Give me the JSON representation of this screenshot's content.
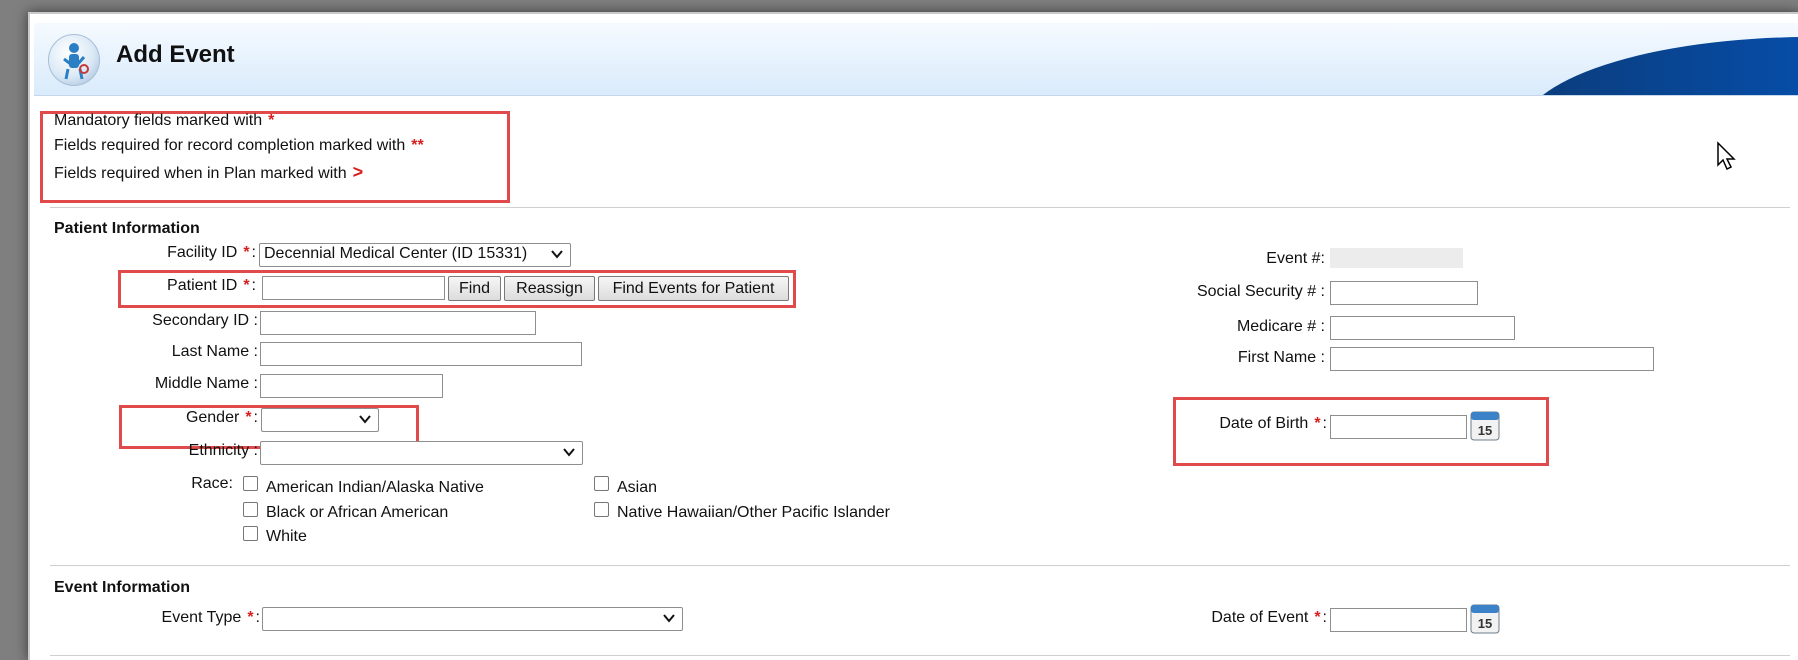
{
  "page": {
    "title": "Add Event"
  },
  "legend": {
    "mandatory": "Mandatory fields marked with",
    "mandatory_mark": "*",
    "completion": "Fields required for record completion marked with",
    "completion_mark": "**",
    "plan": "Fields required when in Plan marked with",
    "plan_mark": ">"
  },
  "patient": {
    "section_title": "Patient Information",
    "facility_label": "Facility ID",
    "facility_value": "Decennial Medical Center (ID 15331)",
    "patient_id_label": "Patient ID",
    "patient_id_value": "",
    "find_button": "Find",
    "reassign_button": "Reassign",
    "find_events_button": "Find Events for Patient",
    "secondary_id_label": "Secondary ID :",
    "last_name_label": "Last Name :",
    "middle_name_label": "Middle Name :",
    "gender_label": "Gender",
    "gender_value": "",
    "ethnicity_label": "Ethnicity :",
    "ethnicity_value": "",
    "race_label": "Race:",
    "race_options": {
      "american_indian": "American Indian/Alaska Native",
      "asian": "Asian",
      "black": "Black or African American",
      "hawaiian": "Native Hawaiian/Other Pacific Islander",
      "white": "White"
    },
    "event_num_label": "Event #:",
    "ssn_label": "Social Security # :",
    "medicare_label": "Medicare # :",
    "first_name_label": "First Name :",
    "dob_label": "Date of Birth",
    "dob_value": "",
    "required_mark": "*",
    "colon": ":"
  },
  "event": {
    "section_title": "Event Information",
    "type_label": "Event Type",
    "type_value": "",
    "date_label": "Date of Event",
    "date_value": ""
  },
  "calendar": {
    "day": "15"
  },
  "icons": {
    "logo": "medical-logo-icon",
    "calendar": "calendar-icon",
    "cursor": "mouse-cursor-icon",
    "dropdown": "chevron-down-icon"
  },
  "colors": {
    "required": "#d71f1f",
    "highlight": "#e04a4a",
    "header_bg": "#d9ebfb",
    "swoosh": "#064fad"
  }
}
